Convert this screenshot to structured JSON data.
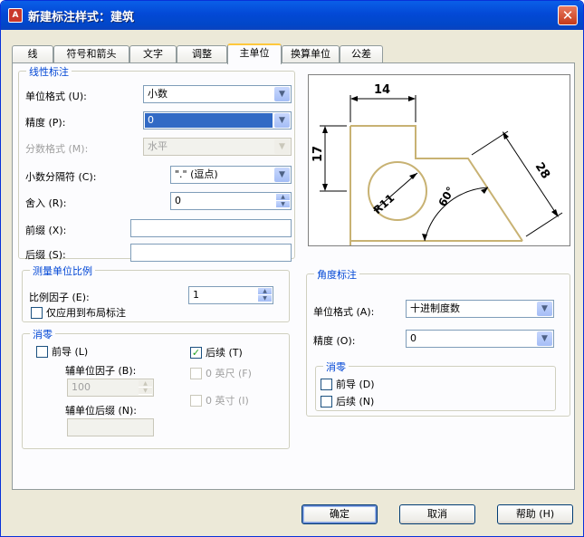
{
  "window": {
    "title": "新建标注样式：建筑",
    "close_glyph": "✕"
  },
  "tabs": [
    {
      "label": "线"
    },
    {
      "label": "符号和箭头"
    },
    {
      "label": "文字"
    },
    {
      "label": "调整"
    },
    {
      "label": "主单位"
    },
    {
      "label": "换算单位"
    },
    {
      "label": "公差"
    }
  ],
  "active_tab": "主单位",
  "linear": {
    "title": "线性标注",
    "unit_format_label": "单位格式 (U):",
    "unit_format_value": "小数",
    "precision_label": "精度 (P):",
    "precision_value": "0",
    "fraction_format_label": "分数格式 (M):",
    "fraction_format_value": "水平",
    "decimal_separator_label": "小数分隔符 (C):",
    "decimal_separator_value": "\".\" (逗点)",
    "round_off_label": "舍入 (R):",
    "round_off_value": "0",
    "prefix_label": "前缀 (X):",
    "prefix_value": "",
    "suffix_label": "后缀 (S):",
    "suffix_value": ""
  },
  "scale": {
    "title": "测量单位比例",
    "factor_label": "比例因子 (E):",
    "factor_value": "1",
    "layout_only_label": "仅应用到布局标注",
    "layout_only_checked": false
  },
  "zero_suppression": {
    "title": "消零",
    "leading_label": "前导 (L)",
    "leading_checked": false,
    "trailing_label": "后续 (T)",
    "trailing_checked": true,
    "sub_units_factor_label": "辅单位因子 (B):",
    "sub_units_factor_value": "100",
    "sub_units_suffix_label": "辅单位后缀 (N):",
    "sub_units_suffix_value": "",
    "feet_label": "0 英尺 (F)",
    "inches_label": "0 英寸 (I)"
  },
  "angular": {
    "title": "角度标注",
    "unit_format_label": "单位格式 (A):",
    "unit_format_value": "十进制度数",
    "precision_label": "精度 (O):",
    "precision_value": "0",
    "zero_title": "消零",
    "leading_label": "前导 (D)",
    "leading_checked": false,
    "trailing_label": "后续 (N)",
    "trailing_checked": false
  },
  "preview": {
    "dim_top": "14",
    "dim_left": "17",
    "dim_diag": "28",
    "dim_radius": "R11",
    "dim_angle": "60°",
    "line_color": "#c8b273",
    "dim_color": "#000000"
  },
  "buttons": {
    "ok": "确定",
    "cancel": "取消",
    "help": "帮助 (H)"
  },
  "colors": {
    "accent": "#0046d5",
    "selection": "#316ac5",
    "title_bar": "#0349d6"
  }
}
